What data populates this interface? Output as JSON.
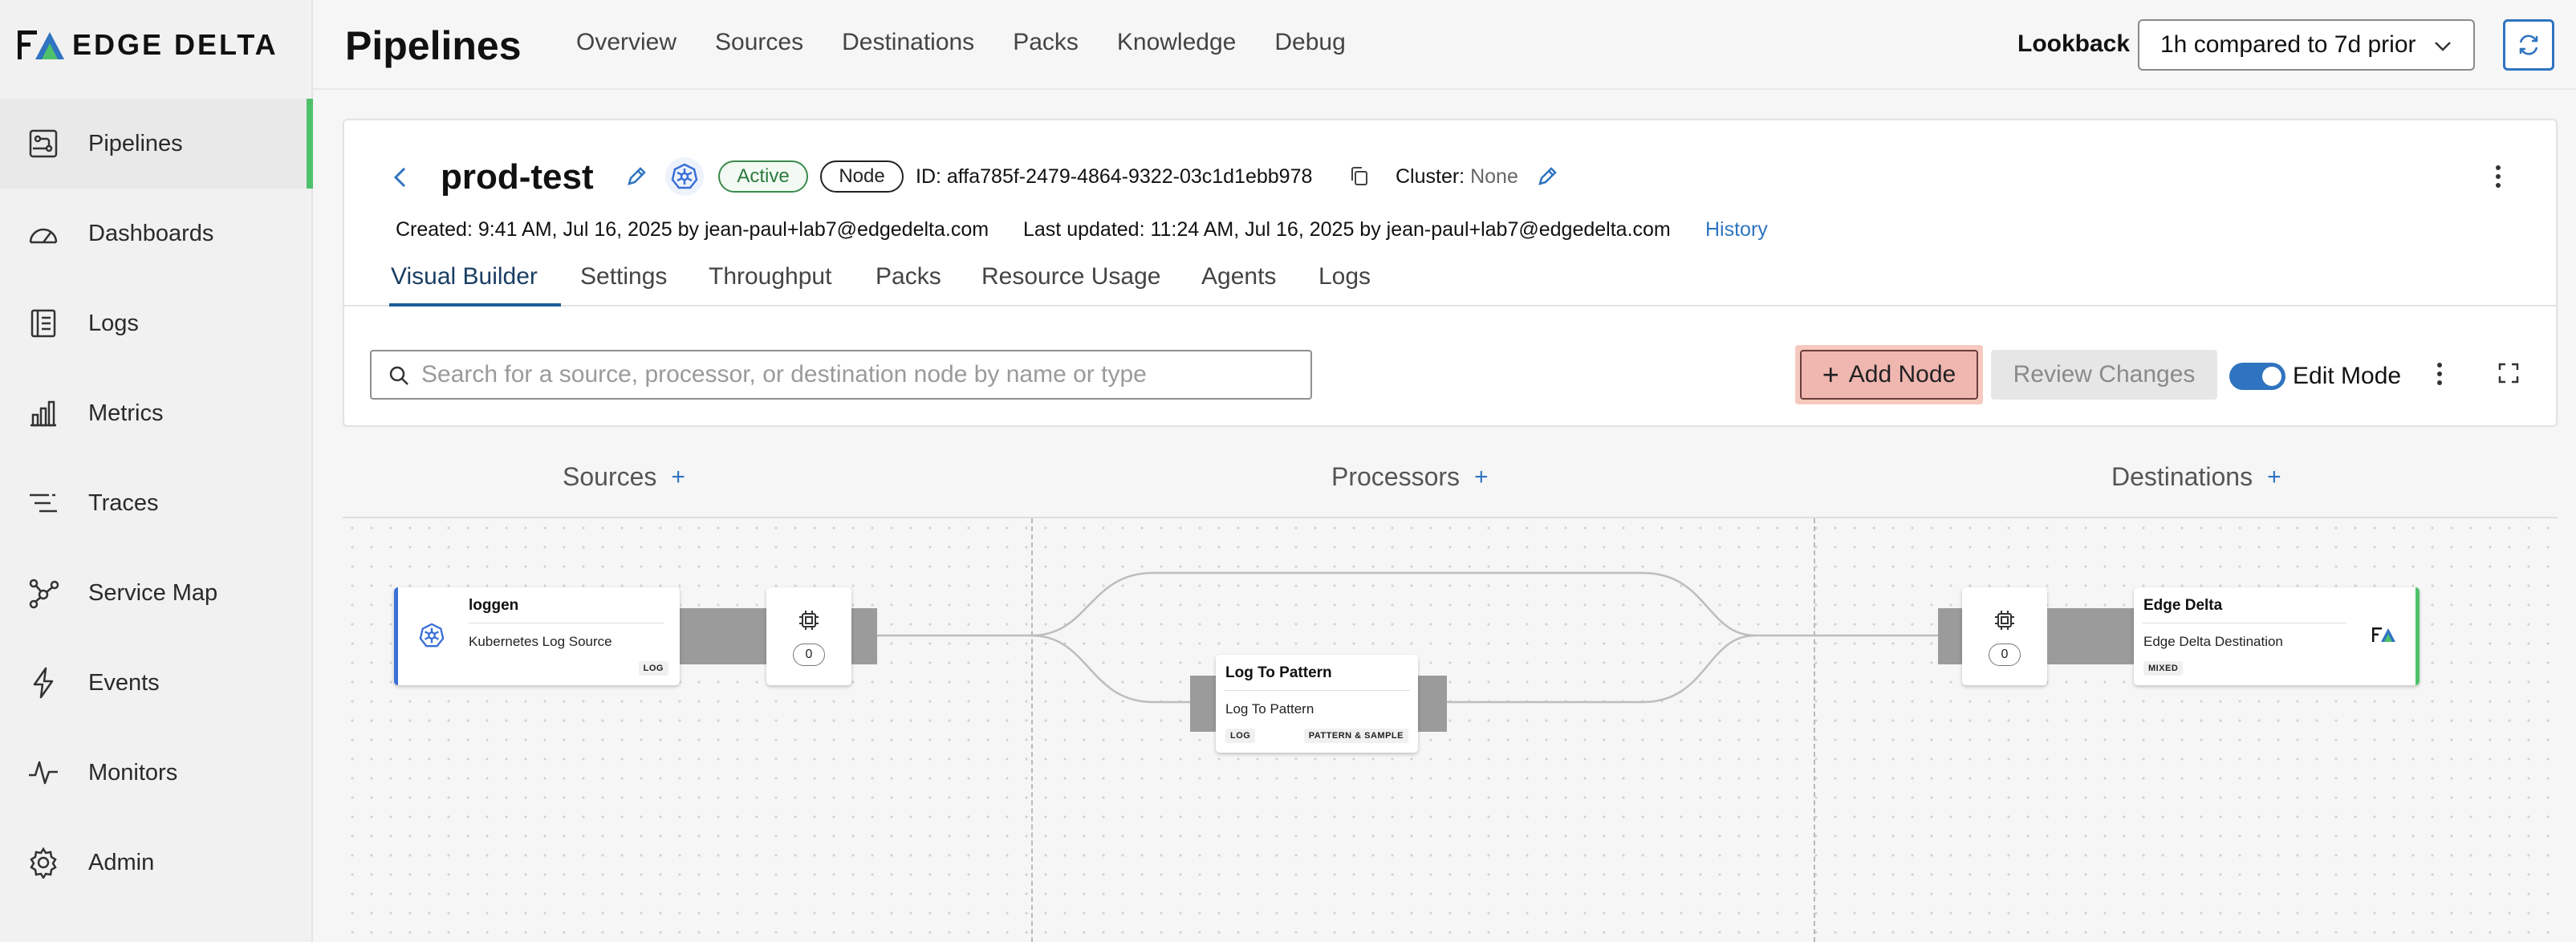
{
  "brand": {
    "logo_text": "EDGE DELTA",
    "accent": "#4fc16b"
  },
  "sidebar": {
    "items": [
      {
        "label": "Pipelines",
        "icon": "pipelines-icon",
        "active": true
      },
      {
        "label": "Dashboards",
        "icon": "dashboard-gauge-icon"
      },
      {
        "label": "Logs",
        "icon": "logs-icon"
      },
      {
        "label": "Metrics",
        "icon": "bar-chart-icon"
      },
      {
        "label": "Traces",
        "icon": "traces-icon"
      },
      {
        "label": "Service Map",
        "icon": "service-map-icon"
      },
      {
        "label": "Events",
        "icon": "lightning-icon"
      },
      {
        "label": "Monitors",
        "icon": "pulse-icon"
      },
      {
        "label": "Admin",
        "icon": "gear-icon"
      }
    ]
  },
  "header": {
    "title": "Pipelines",
    "tabs": [
      "Overview",
      "Sources",
      "Destinations",
      "Packs",
      "Knowledge",
      "Debug"
    ],
    "lookback_label": "Lookback",
    "lookback_value": "1h compared to 7d prior"
  },
  "pipeline": {
    "name": "prod-test",
    "status": "Active",
    "type": "Node",
    "id_text": "ID: affa785f-2479-4864-9322-03c1d1ebb978",
    "cluster_label": "Cluster:",
    "cluster_value": "None",
    "created": "Created: 9:41 AM, Jul 16, 2025 by jean-paul+lab7@edgedelta.com",
    "updated": "Last updated: 11:24 AM, Jul 16, 2025 by jean-paul+lab7@edgedelta.com",
    "history_link": "History"
  },
  "sub_tabs": [
    "Visual Builder",
    "Settings",
    "Throughput",
    "Packs",
    "Resource Usage",
    "Agents",
    "Logs"
  ],
  "toolbar": {
    "search_placeholder": "Search for a source, processor, or destination node by name or type",
    "add_node_label": "Add Node",
    "review_label": "Review Changes",
    "edit_mode_label": "Edit Mode",
    "edit_mode_on": true
  },
  "canvas": {
    "columns": [
      "Sources",
      "Processors",
      "Destinations"
    ],
    "source_node": {
      "title": "loggen",
      "subtitle": "Kubernetes Log Source",
      "tag": "LOG"
    },
    "source_counter": "0",
    "processor_node": {
      "title": "Log To Pattern",
      "subtitle": "Log To Pattern",
      "tag_left": "LOG",
      "tag_right": "PATTERN & SAMPLE"
    },
    "dest_counter": "0",
    "dest_node": {
      "title": "Edge Delta",
      "subtitle": "Edge Delta Destination",
      "tag": "MIXED"
    }
  }
}
